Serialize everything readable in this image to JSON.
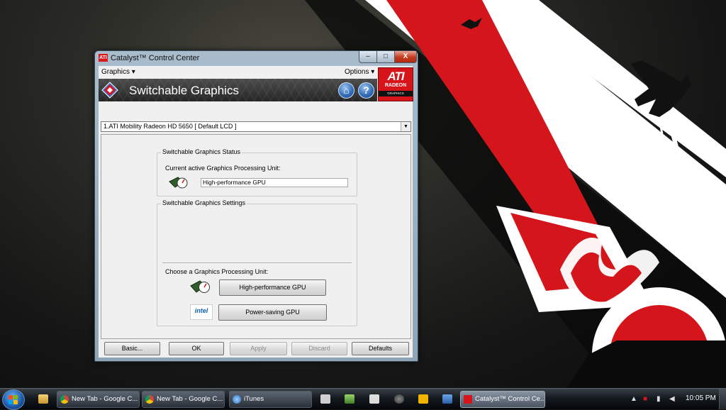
{
  "window": {
    "title": "Catalyst™ Control Center",
    "icon_label": "ATI",
    "minimize_label": "–",
    "maximize_label": "□",
    "close_label": "X"
  },
  "menubar": {
    "graphics": "Graphics ▾",
    "options": "Options ▾"
  },
  "banner": {
    "title": "Switchable Graphics",
    "home_label": "⌂",
    "help_label": "?",
    "logo": {
      "brand": "ATI",
      "line1": "RADEON",
      "line2": "GRAPHICS"
    }
  },
  "device_select": {
    "value": "1.ATI Mobility Radeon HD 5650 [ Default LCD ]",
    "arrow": "▼"
  },
  "status_group": {
    "label": "Switchable Graphics Status",
    "current_label": "Current active Graphics Processing Unit:",
    "current_value": "High-performance GPU"
  },
  "settings_group": {
    "label": "Switchable Graphics Settings",
    "choose_label": "Choose a Graphics Processing Unit:",
    "high_perf_button": "High-performance GPU",
    "power_saving_button": "Power-saving GPU",
    "intel_label": "intel"
  },
  "footer": {
    "basic": "Basic...",
    "ok": "OK",
    "apply": "Apply",
    "discard": "Discard",
    "defaults": "Defaults"
  },
  "taskbar": {
    "tasks": [
      {
        "label": "New Tab - Google C..."
      },
      {
        "label": "New Tab - Google C..."
      },
      {
        "label": "iTunes"
      },
      {
        "label": "Catalyst™ Control Ce..."
      }
    ],
    "clock": "10:05 PM"
  },
  "colors": {
    "ati_red": "#d8141b",
    "banner_dark": "#2e2e2e",
    "window_frame": "#9fb3c6",
    "taskbar": "#10151b"
  }
}
